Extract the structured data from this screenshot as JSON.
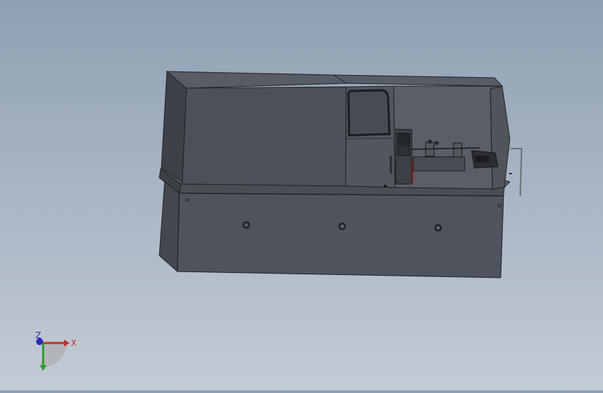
{
  "viewport": {
    "background_top": "#8fa0b3",
    "background_bottom": "#c3cbd5",
    "model_body_color": "#4f535b",
    "model_panel_color": "#565a62",
    "model_window_color": "#4a4e56",
    "model_edge_color": "#1e2024"
  },
  "triad": {
    "x_label": "X",
    "z_label": "Z",
    "x_color": "#c0322a",
    "y_color": "#2a9b2a",
    "z_color": "#2a2ab5"
  }
}
